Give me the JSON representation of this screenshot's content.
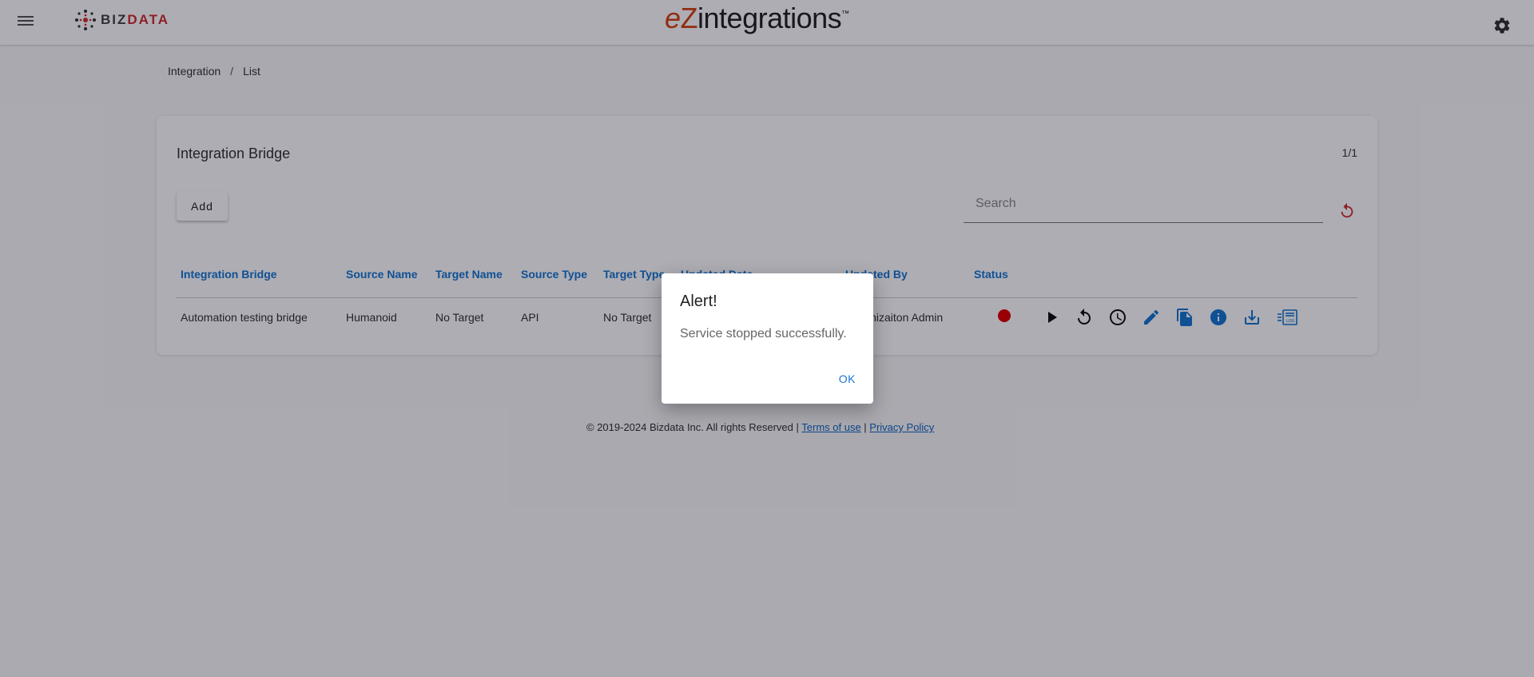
{
  "header": {
    "logo_left_biz": "BIZ",
    "logo_left_data": "DATA",
    "brand_e": "e",
    "brand_z": "Z",
    "brand_rest": "integrations",
    "brand_tm": "™"
  },
  "breadcrumb": [
    "Integration",
    "/",
    "List"
  ],
  "card": {
    "title": "Integration Bridge",
    "pager": "1/1",
    "add_label": "Add",
    "search_placeholder": "Search"
  },
  "table": {
    "columns": [
      "Integration Bridge",
      "Source Name",
      "Target Name",
      "Source Type",
      "Target Type",
      "Updated Date",
      "Updated By",
      "Status"
    ],
    "rows": [
      {
        "integration_bridge": "Automation testing bridge",
        "source_name": "Humanoid",
        "target_name": "No Target",
        "source_type": "API",
        "target_type": "No Target",
        "updated_by": "Organizaiton Admin",
        "status": "stopped"
      }
    ],
    "actions": [
      "play-icon",
      "restart-icon",
      "schedule-icon",
      "edit-icon",
      "copy-icon",
      "info-icon",
      "download-icon",
      "logs-icon"
    ]
  },
  "footer": {
    "copyright": "© 2019-2024 Bizdata Inc. All rights Reserved | ",
    "terms": "Terms of use",
    "separator": " | ",
    "privacy": "Privacy Policy"
  },
  "dialog": {
    "title": "Alert!",
    "message": "Service stopped successfully.",
    "ok_label": "OK"
  },
  "colors": {
    "accent": "#1976d2",
    "brand_orange": "#d84315",
    "status_stopped": "#e00000",
    "logo_red": "#d32f2f"
  }
}
